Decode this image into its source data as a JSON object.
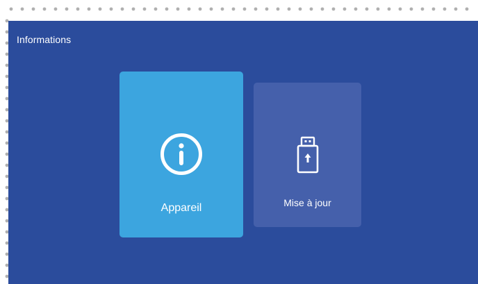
{
  "screen": {
    "title": "Informations"
  },
  "tiles": [
    {
      "label": "Appareil",
      "icon": "info-icon",
      "state": "selected"
    },
    {
      "label": "Mise à jour",
      "icon": "usb-update-icon",
      "state": "default"
    }
  ],
  "colors": {
    "background": "#2b4c9c",
    "tile_selected": "#3ca5df",
    "tile_default": "#4560ab",
    "frame_dots": "#b0b0b0"
  }
}
